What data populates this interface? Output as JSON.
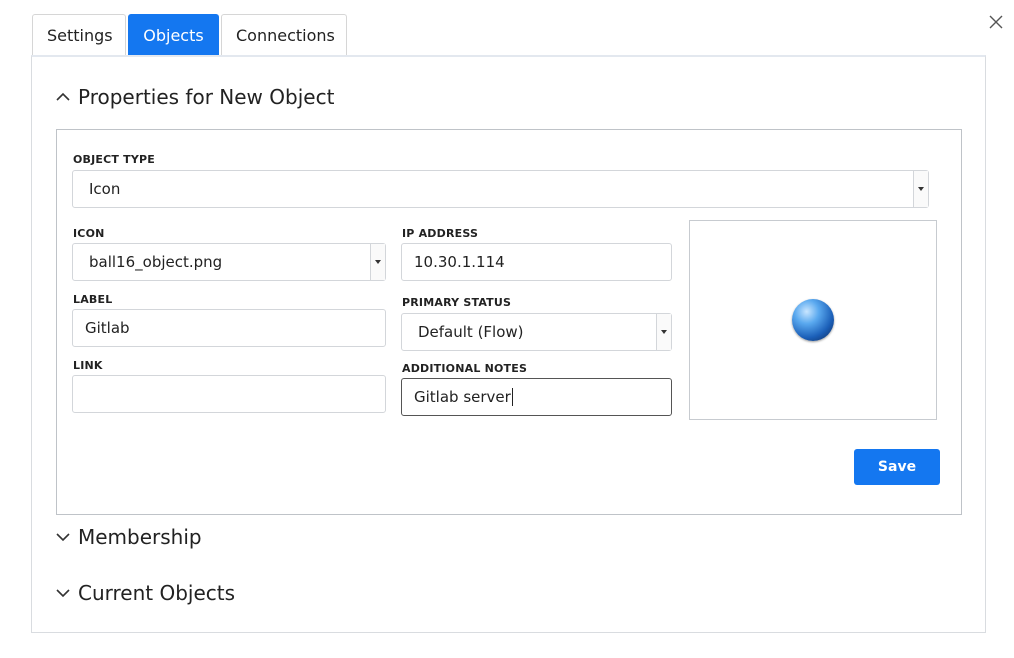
{
  "tabs": [
    {
      "label": "Settings",
      "active": false
    },
    {
      "label": "Objects",
      "active": true
    },
    {
      "label": "Connections",
      "active": false
    }
  ],
  "sections": {
    "properties": {
      "title": "Properties for New Object",
      "expanded": true
    },
    "membership": {
      "title": "Membership",
      "expanded": false
    },
    "current_objects": {
      "title": "Current Objects",
      "expanded": false
    }
  },
  "form": {
    "object_type": {
      "label": "OBJECT TYPE",
      "value": "Icon"
    },
    "icon": {
      "label": "ICON",
      "value": "ball16_object.png"
    },
    "label": {
      "label": "LABEL",
      "value": "Gitlab"
    },
    "link": {
      "label": "LINK",
      "value": ""
    },
    "ip_address": {
      "label": "IP ADDRESS",
      "value": "10.30.1.114"
    },
    "primary_status": {
      "label": "PRIMARY STATUS",
      "value": "Default (Flow)"
    },
    "additional_notes": {
      "label": "ADDITIONAL NOTES",
      "value": "Gitlab server"
    },
    "save_label": "Save"
  },
  "colors": {
    "accent": "#1477f0"
  },
  "icons": {
    "close": "close-icon",
    "collapse": "chevron-up-icon",
    "expand": "chevron-down-icon",
    "preview": "ball-object-icon"
  }
}
